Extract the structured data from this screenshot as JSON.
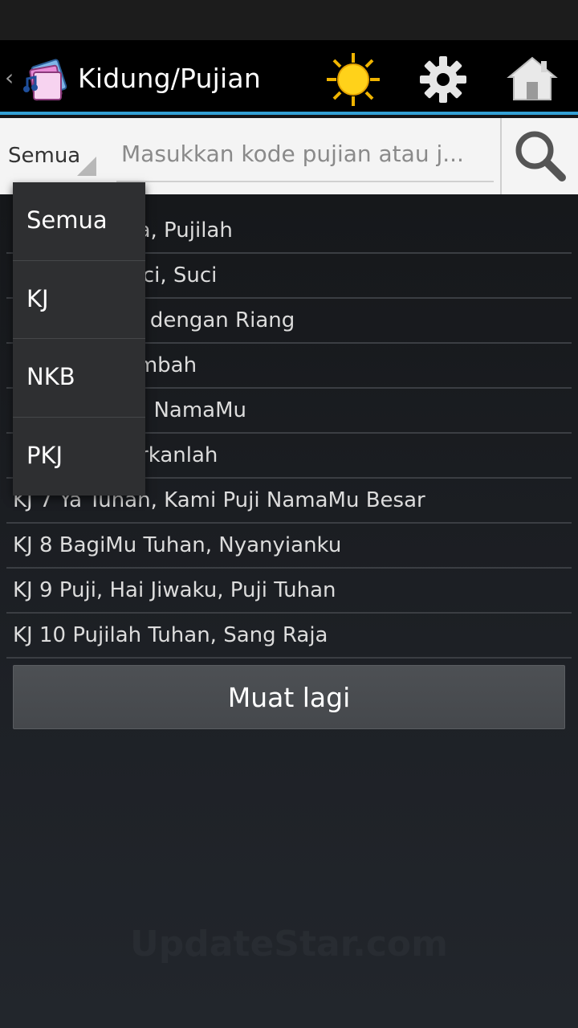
{
  "app": {
    "title": "Kidung/Pujian",
    "up_caret": "‹"
  },
  "search": {
    "filter_selected": "Semua",
    "placeholder": "Masukkan kode pujian atau j..."
  },
  "songs": [
    "KJ 1  Haleluya, Pujilah",
    "KJ 2  Suci, Suci, Suci",
    "KJ 3  Kita Puji dengan Riang",
    "KJ 4  Mari Sembah",
    "KJ 5  Ya Allah, NamaMu",
    "KJ 6  Masyhurkanlah",
    "KJ 7  Ya Tuhan, Kami Puji NamaMu Besar",
    "KJ 8  BagiMu Tuhan, Nyanyianku",
    "KJ 9  Puji, Hai Jiwaku, Puji Tuhan",
    "KJ 10  Pujilah Tuhan, Sang Raja"
  ],
  "reload_label": "Muat lagi",
  "dropdown": {
    "options": [
      "Semua",
      "KJ",
      "NKB",
      "PKJ"
    ]
  },
  "watermark": "UpdateStar.com",
  "colors": {
    "accent": "#33a1d6",
    "action_bar": "#000000",
    "search_bg": "#f4f4f4",
    "dropdown_bg": "#2e2f31"
  },
  "icons": [
    "app-book-icon",
    "sun-icon",
    "gear-icon",
    "home-icon",
    "search-icon"
  ]
}
